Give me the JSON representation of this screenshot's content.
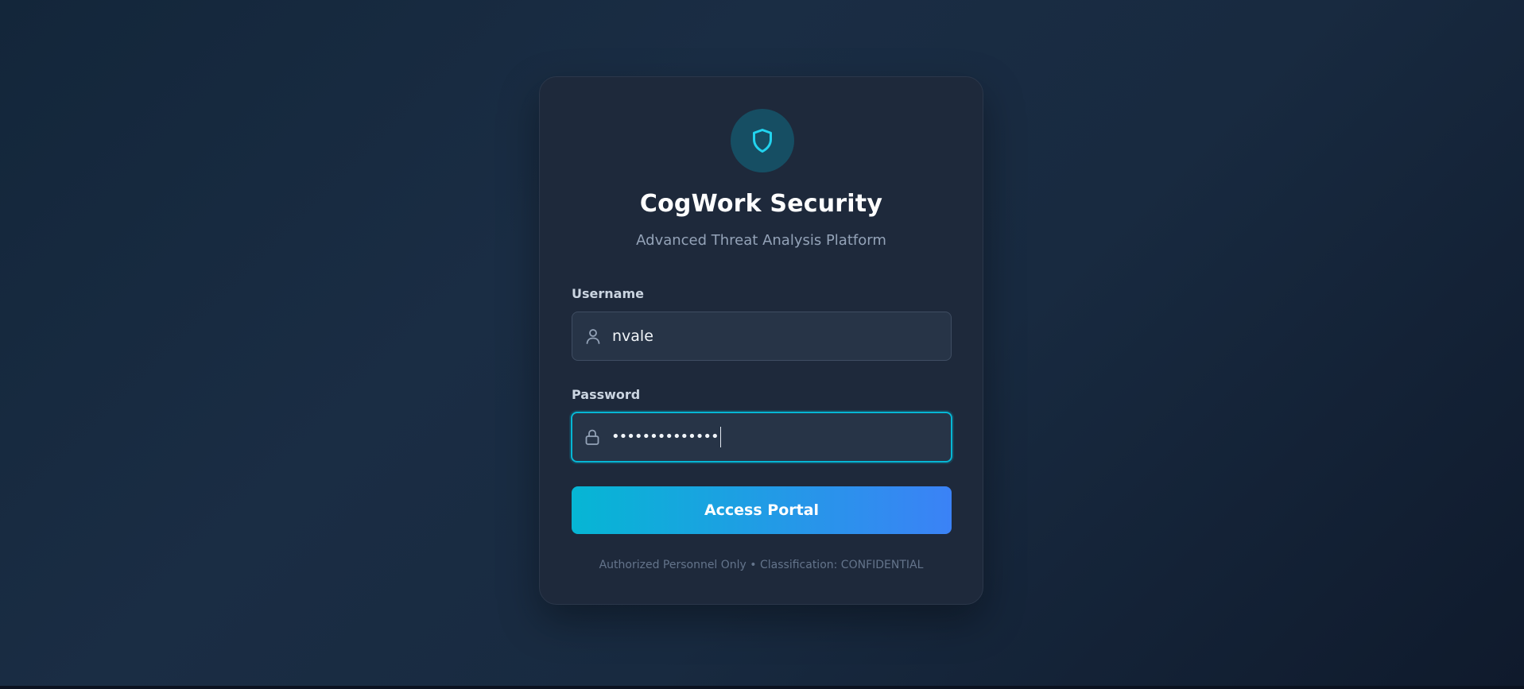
{
  "card": {
    "title": "CogWork Security",
    "subtitle": "Advanced Threat Analysis Platform",
    "logo_icon": "shield-icon"
  },
  "form": {
    "username": {
      "label": "Username",
      "value": "nvale",
      "icon": "user-icon"
    },
    "password": {
      "label": "Password",
      "value": "••••••••••••••",
      "icon": "lock-icon",
      "focused": true
    },
    "submit_label": "Access Portal"
  },
  "footer": {
    "note": "Authorized Personnel Only • Classification: CONFIDENTIAL"
  },
  "colors": {
    "accent": "#06b6d4",
    "accent_end": "#3b82f6",
    "card_bg": "#1e293b",
    "page_bg": "#16283d"
  }
}
